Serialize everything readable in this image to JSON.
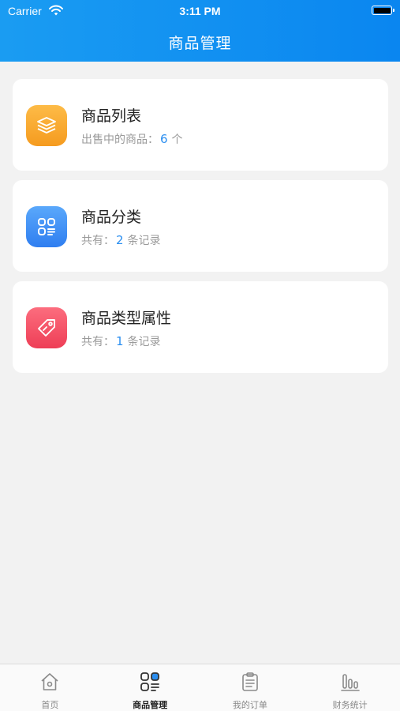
{
  "status_bar": {
    "carrier": "Carrier",
    "time": "3:11 PM"
  },
  "header": {
    "title": "商品管理"
  },
  "cards": [
    {
      "title": "商品列表",
      "prefix": "出售中的商品：",
      "count": "6",
      "suffix": "个",
      "icon": "layers-icon",
      "color": "#f7a42a"
    },
    {
      "title": "商品分类",
      "prefix": "共有：",
      "count": "2",
      "suffix": "条记录",
      "icon": "category-grid-icon",
      "color": "#3a8cf4"
    },
    {
      "title": "商品类型属性",
      "prefix": "共有：",
      "count": "1",
      "suffix": "条记录",
      "icon": "price-tag-icon",
      "color": "#f24c62"
    }
  ],
  "tabs": [
    {
      "label": "首页",
      "icon": "home-icon"
    },
    {
      "label": "商品管理",
      "icon": "category-grid-icon",
      "active": true
    },
    {
      "label": "我的订单",
      "icon": "clipboard-icon"
    },
    {
      "label": "财务统计",
      "icon": "bar-chart-icon"
    }
  ],
  "colors": {
    "header": "#0f8ff1",
    "accent_number": "#2a8ef0",
    "background": "#f2f2f2"
  }
}
